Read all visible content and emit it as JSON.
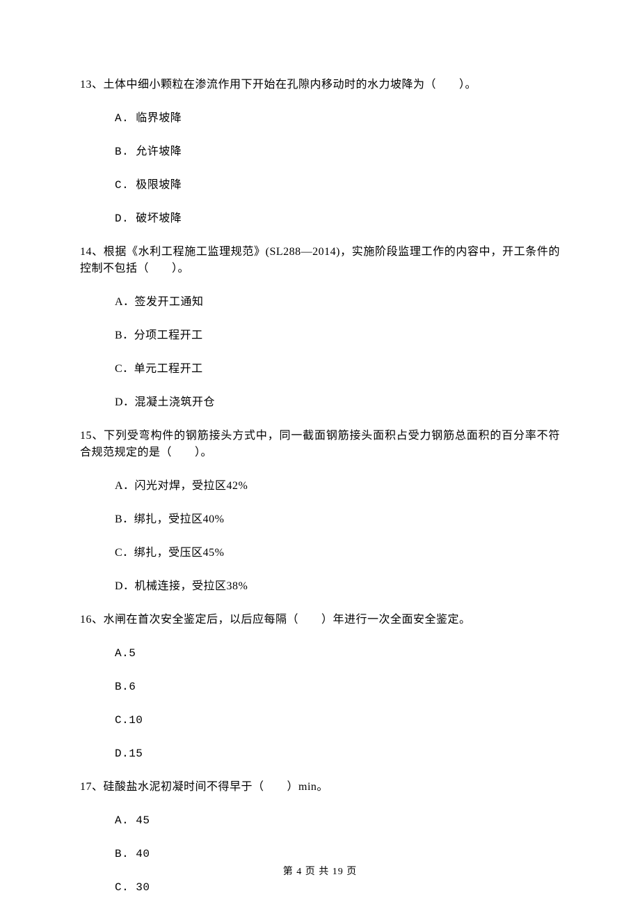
{
  "q13": {
    "stem": "13、土体中细小颗粒在渗流作用下开始在孔隙内移动时的水力坡降为（　　）。",
    "options": {
      "a": "A. 临界坡降",
      "b": "B. 允许坡降",
      "c": "C. 极限坡降",
      "d": "D. 破坏坡降"
    }
  },
  "q14": {
    "stem": "14、根据《水利工程施工监理规范》(SL288—2014)，实施阶段监理工作的内容中，开工条件的控制不包括（　　）。",
    "options": {
      "a": "A．签发开工通知",
      "b": "B．分项工程开工",
      "c": "C．单元工程开工",
      "d": "D．混凝土浇筑开仓"
    }
  },
  "q15": {
    "stem": "15、下列受弯构件的钢筋接头方式中，同一截面钢筋接头面积占受力钢筋总面积的百分率不符合规范规定的是（　　）。",
    "options": {
      "a": "A．闪光对焊，受拉区42%",
      "b": "B．绑扎，受拉区40%",
      "c": "C．绑扎，受压区45%",
      "d": "D．机械连接，受拉区38%"
    }
  },
  "q16": {
    "stem": "16、水闸在首次安全鉴定后，以后应每隔（　　）年进行一次全面安全鉴定。",
    "options": {
      "a": "A.5",
      "b": "B.6",
      "c": "C.10",
      "d": "D.15"
    }
  },
  "q17": {
    "stem": "17、硅酸盐水泥初凝时间不得早于（　　）min。",
    "options": {
      "a": "A. 45",
      "b": "B. 40",
      "c": "C. 30"
    }
  },
  "footer": "第 4 页 共 19 页"
}
